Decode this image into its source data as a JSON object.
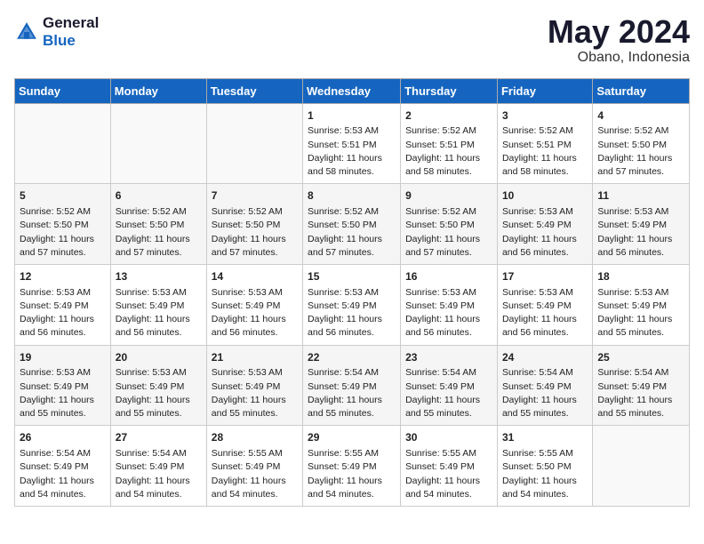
{
  "header": {
    "logo_general": "General",
    "logo_blue": "Blue",
    "title": "May 2024",
    "location": "Obano, Indonesia"
  },
  "calendar": {
    "days_of_week": [
      "Sunday",
      "Monday",
      "Tuesday",
      "Wednesday",
      "Thursday",
      "Friday",
      "Saturday"
    ],
    "weeks": [
      [
        {
          "day": "",
          "info": ""
        },
        {
          "day": "",
          "info": ""
        },
        {
          "day": "",
          "info": ""
        },
        {
          "day": "1",
          "info": "Sunrise: 5:53 AM\nSunset: 5:51 PM\nDaylight: 11 hours\nand 58 minutes."
        },
        {
          "day": "2",
          "info": "Sunrise: 5:52 AM\nSunset: 5:51 PM\nDaylight: 11 hours\nand 58 minutes."
        },
        {
          "day": "3",
          "info": "Sunrise: 5:52 AM\nSunset: 5:51 PM\nDaylight: 11 hours\nand 58 minutes."
        },
        {
          "day": "4",
          "info": "Sunrise: 5:52 AM\nSunset: 5:50 PM\nDaylight: 11 hours\nand 57 minutes."
        }
      ],
      [
        {
          "day": "5",
          "info": "Sunrise: 5:52 AM\nSunset: 5:50 PM\nDaylight: 11 hours\nand 57 minutes."
        },
        {
          "day": "6",
          "info": "Sunrise: 5:52 AM\nSunset: 5:50 PM\nDaylight: 11 hours\nand 57 minutes."
        },
        {
          "day": "7",
          "info": "Sunrise: 5:52 AM\nSunset: 5:50 PM\nDaylight: 11 hours\nand 57 minutes."
        },
        {
          "day": "8",
          "info": "Sunrise: 5:52 AM\nSunset: 5:50 PM\nDaylight: 11 hours\nand 57 minutes."
        },
        {
          "day": "9",
          "info": "Sunrise: 5:52 AM\nSunset: 5:50 PM\nDaylight: 11 hours\nand 57 minutes."
        },
        {
          "day": "10",
          "info": "Sunrise: 5:53 AM\nSunset: 5:49 PM\nDaylight: 11 hours\nand 56 minutes."
        },
        {
          "day": "11",
          "info": "Sunrise: 5:53 AM\nSunset: 5:49 PM\nDaylight: 11 hours\nand 56 minutes."
        }
      ],
      [
        {
          "day": "12",
          "info": "Sunrise: 5:53 AM\nSunset: 5:49 PM\nDaylight: 11 hours\nand 56 minutes."
        },
        {
          "day": "13",
          "info": "Sunrise: 5:53 AM\nSunset: 5:49 PM\nDaylight: 11 hours\nand 56 minutes."
        },
        {
          "day": "14",
          "info": "Sunrise: 5:53 AM\nSunset: 5:49 PM\nDaylight: 11 hours\nand 56 minutes."
        },
        {
          "day": "15",
          "info": "Sunrise: 5:53 AM\nSunset: 5:49 PM\nDaylight: 11 hours\nand 56 minutes."
        },
        {
          "day": "16",
          "info": "Sunrise: 5:53 AM\nSunset: 5:49 PM\nDaylight: 11 hours\nand 56 minutes."
        },
        {
          "day": "17",
          "info": "Sunrise: 5:53 AM\nSunset: 5:49 PM\nDaylight: 11 hours\nand 56 minutes."
        },
        {
          "day": "18",
          "info": "Sunrise: 5:53 AM\nSunset: 5:49 PM\nDaylight: 11 hours\nand 55 minutes."
        }
      ],
      [
        {
          "day": "19",
          "info": "Sunrise: 5:53 AM\nSunset: 5:49 PM\nDaylight: 11 hours\nand 55 minutes."
        },
        {
          "day": "20",
          "info": "Sunrise: 5:53 AM\nSunset: 5:49 PM\nDaylight: 11 hours\nand 55 minutes."
        },
        {
          "day": "21",
          "info": "Sunrise: 5:53 AM\nSunset: 5:49 PM\nDaylight: 11 hours\nand 55 minutes."
        },
        {
          "day": "22",
          "info": "Sunrise: 5:54 AM\nSunset: 5:49 PM\nDaylight: 11 hours\nand 55 minutes."
        },
        {
          "day": "23",
          "info": "Sunrise: 5:54 AM\nSunset: 5:49 PM\nDaylight: 11 hours\nand 55 minutes."
        },
        {
          "day": "24",
          "info": "Sunrise: 5:54 AM\nSunset: 5:49 PM\nDaylight: 11 hours\nand 55 minutes."
        },
        {
          "day": "25",
          "info": "Sunrise: 5:54 AM\nSunset: 5:49 PM\nDaylight: 11 hours\nand 55 minutes."
        }
      ],
      [
        {
          "day": "26",
          "info": "Sunrise: 5:54 AM\nSunset: 5:49 PM\nDaylight: 11 hours\nand 54 minutes."
        },
        {
          "day": "27",
          "info": "Sunrise: 5:54 AM\nSunset: 5:49 PM\nDaylight: 11 hours\nand 54 minutes."
        },
        {
          "day": "28",
          "info": "Sunrise: 5:55 AM\nSunset: 5:49 PM\nDaylight: 11 hours\nand 54 minutes."
        },
        {
          "day": "29",
          "info": "Sunrise: 5:55 AM\nSunset: 5:49 PM\nDaylight: 11 hours\nand 54 minutes."
        },
        {
          "day": "30",
          "info": "Sunrise: 5:55 AM\nSunset: 5:49 PM\nDaylight: 11 hours\nand 54 minutes."
        },
        {
          "day": "31",
          "info": "Sunrise: 5:55 AM\nSunset: 5:50 PM\nDaylight: 11 hours\nand 54 minutes."
        },
        {
          "day": "",
          "info": ""
        }
      ]
    ]
  }
}
